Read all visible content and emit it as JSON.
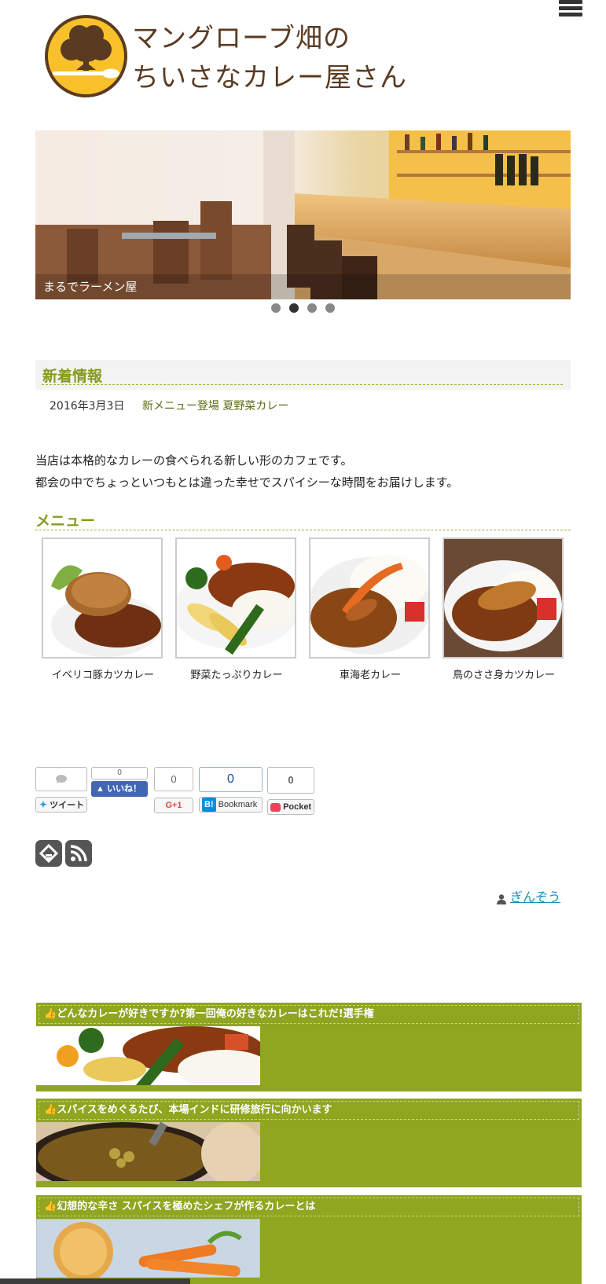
{
  "header": {
    "title_line1": "マングローブ畑の",
    "title_line2": "ちいさなカレー屋さん",
    "menu_icon": "hamburger-menu-icon",
    "logo_icon": "tree-and-spoon-logo"
  },
  "slider": {
    "caption": "まるでラーメン屋",
    "slide_count": 4,
    "active_index": 1
  },
  "news": {
    "heading": "新着情報",
    "items": [
      {
        "date": "2016年3月3日",
        "title": "新メニュー登場 夏野菜カレー"
      }
    ]
  },
  "intro": {
    "line1": "当店は本格的なカレーの食べられる新しい形のカフェです。",
    "line2": "都会の中でちょっといつもとは違った幸せでスパイシーな時間をお届けします。"
  },
  "menu": {
    "heading": "メニュー",
    "items": [
      {
        "label": "イベリコ豚カツカレー"
      },
      {
        "label": "野菜たっぷりカレー"
      },
      {
        "label": "車海老カレー"
      },
      {
        "label": "鳥のささ身カツカレー"
      }
    ]
  },
  "share": {
    "twitter_label": "ツイート",
    "facebook_count": "0",
    "facebook_label": "いいね！",
    "gplus_count": "0",
    "gplus_label": "G+1",
    "hatena_count": "0",
    "hatena_label": "Bookmark",
    "hatena_badge": "B!",
    "pocket_count": "0",
    "pocket_label": "Pocket"
  },
  "author": {
    "name": "ぎんぞう"
  },
  "related_posts": [
    {
      "title": "どんなカレーが好きですか?第一回俺の好きなカレーはこれだ!選手権"
    },
    {
      "title": "スパイスをめぐるたび、本場インドに研修旅行に向かいます"
    },
    {
      "title": "幻想的な辛さ スパイスを極めたシェフが作るカレーとは"
    }
  ],
  "colors": {
    "accent_green": "#90a520",
    "heading_green": "#859b1f",
    "logo_yellow": "#f8c02a",
    "logo_brown": "#5a3b22",
    "link_blue": "#1a8fb5"
  }
}
